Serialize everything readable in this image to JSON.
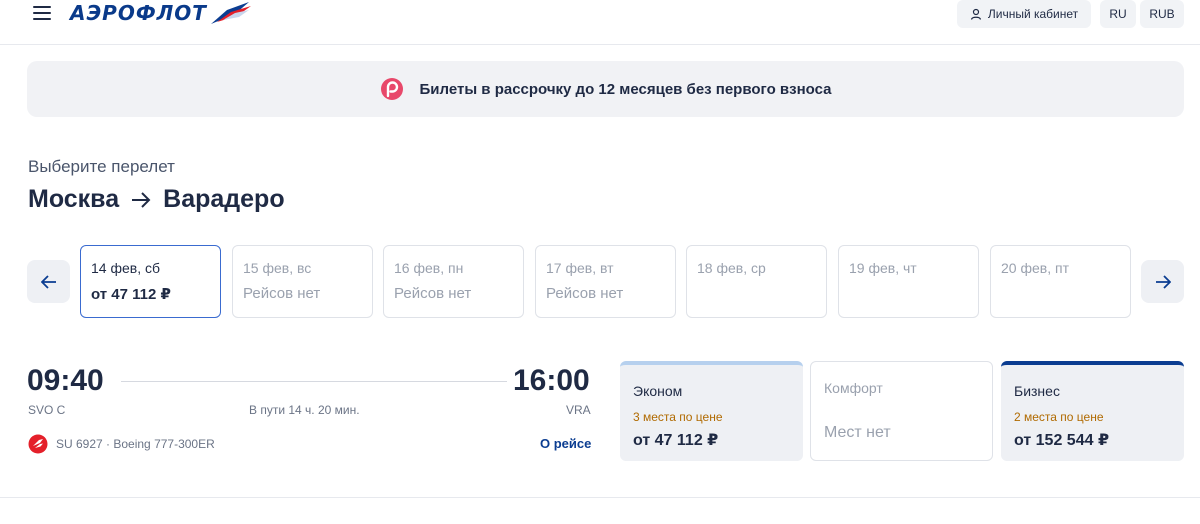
{
  "header": {
    "logo_text": "АЭРОФЛОТ",
    "cabinet_label": "Личный кабинет",
    "language": "RU",
    "currency": "RUB"
  },
  "banner": {
    "text": "Билеты в рассрочку до 12 месяцев без первого взноса"
  },
  "page": {
    "subtitle": "Выберите перелет",
    "route_from": "Москва",
    "route_to": "Варадеро"
  },
  "dates": [
    {
      "label": "14 фев, сб",
      "price": "от 47 112 ₽"
    },
    {
      "label": "15 фев, вс",
      "price": "Рейсов нет"
    },
    {
      "label": "16 фев, пн",
      "price": "Рейсов нет"
    },
    {
      "label": "17 фев, вт",
      "price": "Рейсов нет"
    },
    {
      "label": "18 фев, ср",
      "price": ""
    },
    {
      "label": "19 фев, чт",
      "price": ""
    },
    {
      "label": "20 фев, пт",
      "price": ""
    }
  ],
  "flight": {
    "departure_time": "09:40",
    "arrival_time": "16:00",
    "departure_code": "SVO C",
    "arrival_code": "VRA",
    "duration": "В пути 14 ч. 20 мин.",
    "info": "SU 6927 · Boeing 777-300ER",
    "about_link": "О рейсе"
  },
  "fares": {
    "economy": {
      "name": "Эконом",
      "seats": "3 места по цене",
      "price": "от 47 112 ₽"
    },
    "comfort": {
      "name": "Комфорт",
      "status": "Мест нет"
    },
    "business": {
      "name": "Бизнес",
      "seats": "2 места по цене",
      "price": "от 152 544 ₽"
    }
  },
  "colors": {
    "brand_blue": "#0b3d91",
    "brand_red": "#e4202a",
    "accent_pink": "#e8486a",
    "seats_orange": "#b06a00"
  }
}
